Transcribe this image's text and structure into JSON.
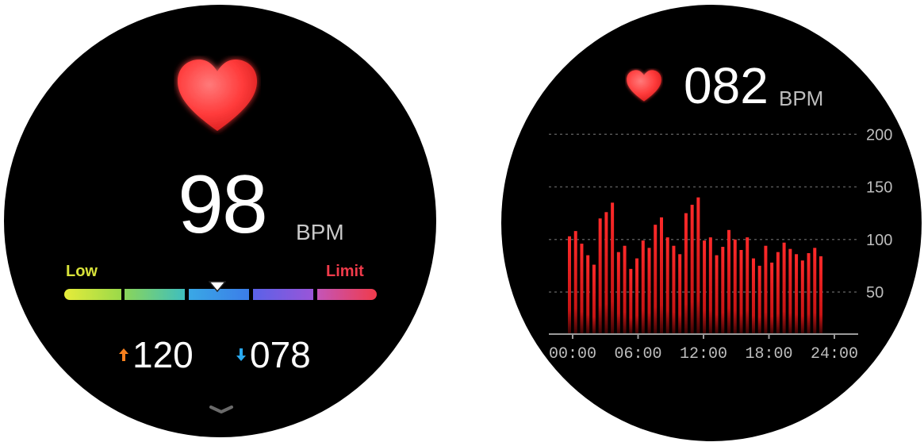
{
  "heart_rate_screen": {
    "bpm_value": "98",
    "bpm_unit": "BPM",
    "zone_low_label": "Low",
    "zone_limit_label": "Limit",
    "zone_marker_fraction": 0.49,
    "max_value": "120",
    "min_value": "078",
    "colors": {
      "heart": "#ff3b3b",
      "low": "#d8e23a",
      "limit": "#f03b4b",
      "up_arrow": "#f7801e",
      "down_arrow": "#29a9f0"
    },
    "icons": {
      "heart": "heart-icon",
      "up": "arrow-up-icon",
      "down": "arrow-down-icon",
      "more": "chevron-down-icon"
    }
  },
  "history_screen": {
    "bpm_value": "082",
    "bpm_unit": "BPM",
    "chart_data": {
      "type": "bar",
      "x_tick_labels": [
        "00:00",
        "06:00",
        "12:00",
        "18:00",
        "24:00"
      ],
      "y_tick_labels": [
        "200",
        "150",
        "100",
        "50"
      ],
      "y_ticks": [
        200,
        150,
        100,
        50
      ],
      "ylim": [
        10,
        210
      ],
      "xlim": [
        0,
        24
      ],
      "grid": true,
      "bar_color": "#ff2a2a",
      "values": [
        103,
        108,
        96,
        85,
        76,
        120,
        126,
        135,
        88,
        94,
        72,
        82,
        99,
        92,
        114,
        121,
        102,
        94,
        86,
        125,
        133,
        140,
        99,
        102,
        85,
        93,
        109,
        100,
        90,
        102,
        82,
        75,
        94,
        78,
        88,
        97,
        91,
        86,
        80,
        87,
        92,
        84
      ]
    }
  }
}
